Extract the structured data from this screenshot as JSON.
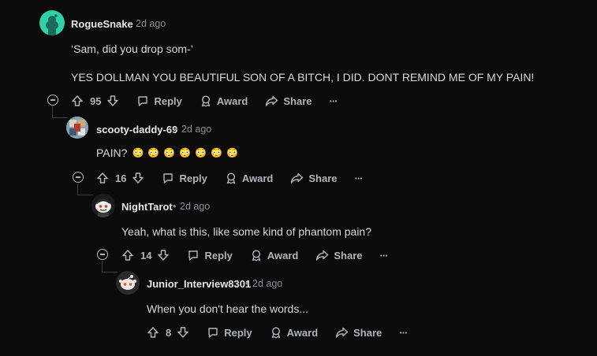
{
  "comments": [
    {
      "user": "RogueSnake",
      "time": "2d ago",
      "lines": [
        "‘Sam, did you drop som-’",
        "YES DOLLMAN YOU BEAUTIFUL SON OF A BITCH, I DID. DONT REMIND ME OF MY PAIN!"
      ],
      "votes": "95",
      "reply": "Reply",
      "award": "Award",
      "share": "Share",
      "avatar_color": "#2ed1a8"
    },
    {
      "user": "scooty-daddy-69",
      "time": "2d ago",
      "lines": [
        "PAIN?"
      ],
      "emojis": [
        "😳",
        "😳",
        "😳",
        "😳",
        "😳",
        "😳",
        "😳"
      ],
      "votes": "16",
      "reply": "Reply",
      "award": "Award",
      "share": "Share"
    },
    {
      "user": "NightTarot",
      "time": "2d ago",
      "lines": [
        "Yeah, what is this, like some kind of phantom pain?"
      ],
      "votes": "14",
      "reply": "Reply",
      "award": "Award",
      "share": "Share"
    },
    {
      "user": "Junior_Interview8301",
      "time": "2d ago",
      "lines": [
        "When you don't hear the words..."
      ],
      "votes": "8",
      "reply": "Reply",
      "award": "Award",
      "share": "Share"
    }
  ],
  "separator": "•",
  "more_label": "···"
}
